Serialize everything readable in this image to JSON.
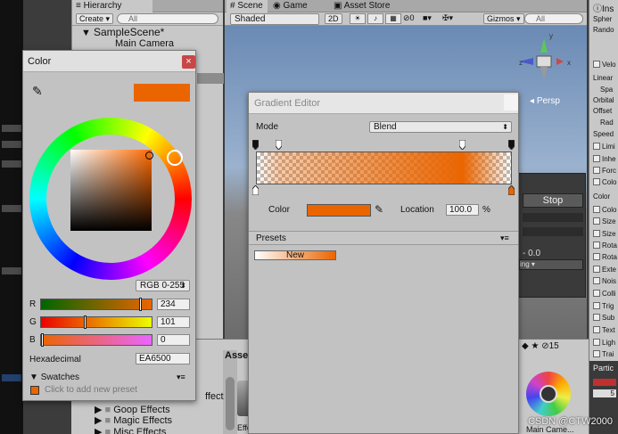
{
  "hierarchy": {
    "tab": "Hierarchy",
    "create_label": "Create",
    "search_placeholder": "All",
    "scene_name": "SampleScene*",
    "items": [
      "Main Camera"
    ]
  },
  "scene": {
    "tabs": [
      "Scene",
      "Game",
      "Asset Store"
    ],
    "shading": "Shaded",
    "mode_2d": "2D",
    "fx_count": "0",
    "gizmos": "Gizmos",
    "search_placeholder": "All",
    "persp_label": "Persp"
  },
  "particle_panel": {
    "stop_label": "Stop",
    "value": "- 0.0"
  },
  "inspector": {
    "tab": "Ins",
    "rows": [
      "Spher",
      "Rando",
      "Velo",
      "Linear",
      "Spa",
      "Orbital",
      "Offset",
      "Rad",
      "Speed",
      "Limi",
      "Inhe",
      "Forc",
      "Colo",
      "Color",
      "Colo",
      "Size",
      "Size",
      "Rota",
      "Rota",
      "Exte",
      "Nois",
      "Colli",
      "Trig",
      "Sub",
      "Text",
      "Ligh",
      "Trai",
      "Partic"
    ],
    "value": "5"
  },
  "project": {
    "tab": "Asse",
    "count": "15",
    "folders": [
      "ffect",
      "Goop Effects",
      "Magic Effects",
      "Misc Effects"
    ],
    "asset_labels": [
      "Effe",
      "Main Came..."
    ]
  },
  "color_picker": {
    "title": "Color",
    "swatch_color": "#EA6500",
    "mode": "RGB 0-255",
    "channels": [
      {
        "label": "R",
        "value": "234",
        "fraction": 0.918
      },
      {
        "label": "G",
        "value": "101",
        "fraction": 0.396
      },
      {
        "label": "B",
        "value": "0",
        "fraction": 0.0
      }
    ],
    "hex_label": "Hexadecimal",
    "hex_value": "EA6500",
    "swatches_label": "Swatches",
    "swatches_hint": "Click to add new preset"
  },
  "gradient_editor": {
    "title": "Gradient Editor",
    "mode_label": "Mode",
    "mode_value": "Blend",
    "color_label": "Color",
    "selected_color": "#EA6500",
    "location_label": "Location",
    "location_value": "100.0",
    "location_unit": "%",
    "presets_label": "Presets",
    "preset_new": "New",
    "alpha_key_positions": [
      0.0,
      0.09,
      0.81,
      1.0
    ],
    "color_key_positions": [
      0.0,
      1.0
    ]
  },
  "watermark": "CSDN @CTW2000"
}
